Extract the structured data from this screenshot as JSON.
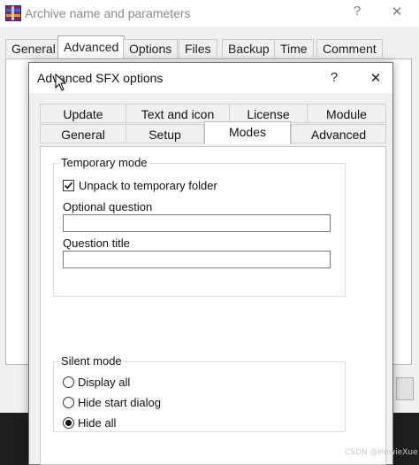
{
  "parent_window": {
    "title": "Archive name and parameters",
    "help_glyph": "?",
    "close_glyph": "✕",
    "tabs": [
      {
        "label": "General"
      },
      {
        "label": "Advanced",
        "active": true
      },
      {
        "label": "Options"
      },
      {
        "label": "Files"
      },
      {
        "label": "Backup"
      },
      {
        "label": "Time"
      },
      {
        "label": "Comment"
      }
    ]
  },
  "dialog": {
    "title": "Advanced SFX options",
    "help_glyph": "?",
    "close_glyph": "✕",
    "tabs_row1": [
      {
        "label": "Update"
      },
      {
        "label": "Text and icon"
      },
      {
        "label": "License"
      },
      {
        "label": "Module"
      }
    ],
    "tabs_row2": [
      {
        "label": "General"
      },
      {
        "label": "Setup"
      },
      {
        "label": "Modes",
        "active": true
      },
      {
        "label": "Advanced"
      }
    ],
    "temporary_mode": {
      "group_label": "Temporary mode",
      "unpack_label": "Unpack to temporary folder",
      "unpack_checked": true,
      "optional_question_label": "Optional question",
      "optional_question_value": "",
      "question_title_label": "Question title",
      "question_title_value": ""
    },
    "silent_mode": {
      "group_label": "Silent mode",
      "options": [
        {
          "label": "Display all",
          "selected": false
        },
        {
          "label": "Hide start dialog",
          "selected": false
        },
        {
          "label": "Hide all",
          "selected": true
        }
      ]
    }
  },
  "watermark": "CSDN @HowieXue"
}
